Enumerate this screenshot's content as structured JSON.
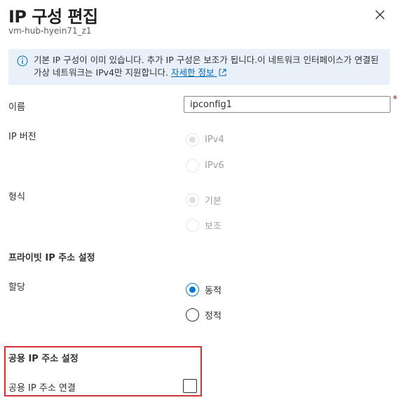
{
  "panel": {
    "title": "IP 구성 편집",
    "subtitle": "vm-hub-hyein71_z1"
  },
  "info": {
    "text": "기본 IP 구성이 이미 있습니다. 추가 IP 구성은 보조가 됩니다.이 네트워크 인터페이스가 연결된 가상 네트워크는 IPv4만 지원합니다.",
    "link_label": "자세한 정보"
  },
  "form": {
    "name_label": "이름",
    "name_value": "ipconfig1",
    "required_mark": "*",
    "ip_version_label": "IP 버전",
    "ip_version_options": [
      "IPv4",
      "IPv6"
    ],
    "ip_version_selected": "IPv4",
    "type_label": "형식",
    "type_options": [
      "기본",
      "보조"
    ],
    "type_selected": "기본"
  },
  "private_ip": {
    "header": "프라이빗 IP 주소 설정",
    "assignment_label": "할당",
    "assignment_options": [
      "동적",
      "정적"
    ],
    "assignment_selected": "동적"
  },
  "public_ip": {
    "header": "공용 IP 주소 설정",
    "associate_label": "공용 IP 주소 연결",
    "associate_checked": false
  },
  "colors": {
    "accent": "#0078d4",
    "highlight_border": "#d13438",
    "info_background": "#e8f1fa"
  }
}
